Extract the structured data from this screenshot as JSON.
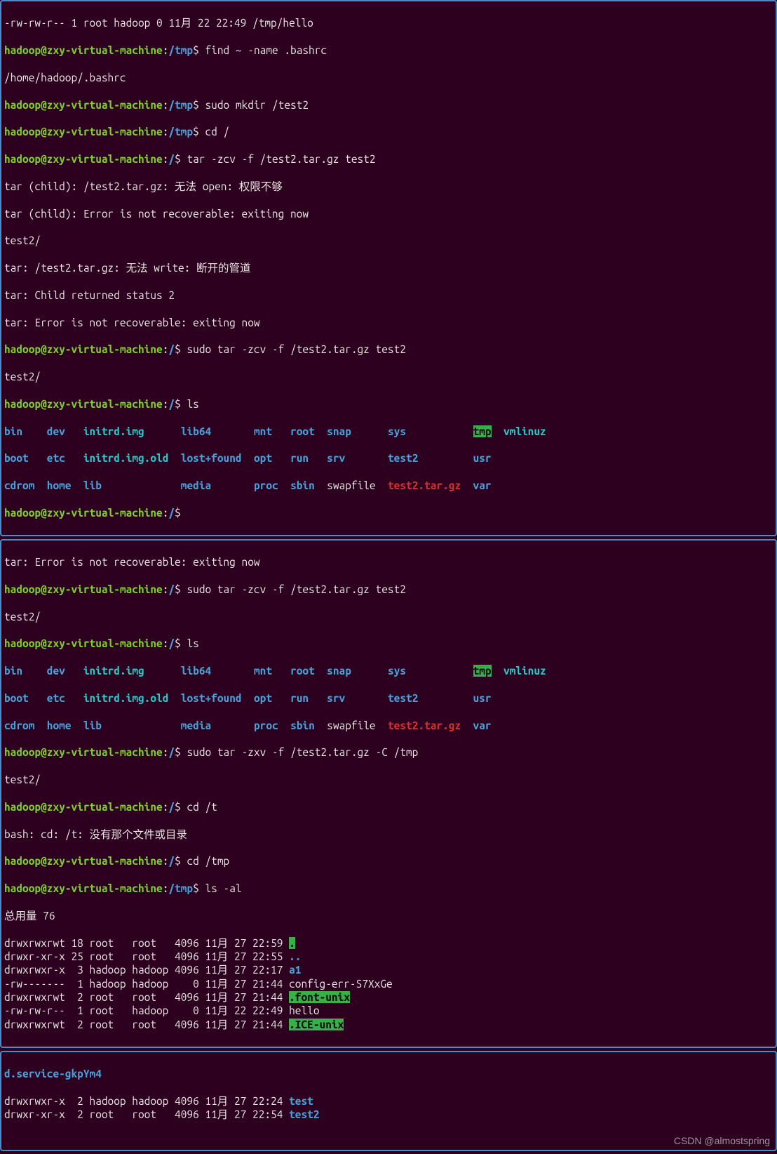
{
  "prompt": {
    "user": "hadoop",
    "host": "zxy-virtual-machine",
    "path_tmp": "/tmp",
    "path_root": "/",
    "sep": "@",
    "dollar": "$"
  },
  "p1": {
    "top_cut": "-rw-rw-r-- 1 root hadoop 0 11月 22 22:49 /tmp/hello",
    "cmd_find": "find ~ -name .bashrc",
    "find_out": "/home/hadoop/.bashrc",
    "cmd_mkdir": "sudo mkdir /test2",
    "cmd_cd_root": "cd /",
    "cmd_tar1": "tar -zcv -f /test2.tar.gz test2",
    "tar_err1": "tar (child): /test2.tar.gz: 无法 open: 权限不够",
    "tar_err2": "tar (child): Error is not recoverable: exiting now",
    "tar_out1": "test2/",
    "tar_err3": "tar: /test2.tar.gz: 无法 write: 断开的管道",
    "tar_err4": "tar: Child returned status 2",
    "tar_err5": "tar: Error is not recoverable: exiting now",
    "cmd_sudo_tar": "sudo tar -zcv -f /test2.tar.gz test2",
    "tar_out2": "test2/",
    "cmd_ls": "ls",
    "ls": {
      "r1": {
        "c1": "bin",
        "c2": "dev",
        "c3": "initrd.img",
        "c4": "lib64",
        "c5": "mnt",
        "c6": "root",
        "c7": "snap",
        "c8": "sys",
        "c9": "tmp",
        "c10": "vmlinuz"
      },
      "r2": {
        "c1": "boot",
        "c2": "etc",
        "c3": "initrd.img.old",
        "c4": "lost+found",
        "c5": "opt",
        "c6": "run",
        "c7": "srv",
        "c8": "test2",
        "c9": "usr"
      },
      "r3": {
        "c1": "cdrom",
        "c2": "home",
        "c3": "lib",
        "c4": "media",
        "c5": "proc",
        "c6": "sbin",
        "c7": "swapfile",
        "c8": "test2.tar.gz",
        "c9": "var"
      }
    }
  },
  "p2": {
    "top_cut": "tar: Error is not recoverable: exiting now",
    "cmd_sudo_tar": "sudo tar -zcv -f /test2.tar.gz test2",
    "tar_out": "test2/",
    "cmd_ls": "ls",
    "cmd_extract": "sudo tar -zxv -f /test2.tar.gz -C /tmp",
    "extract_out": "test2/",
    "cmd_cd_t": "cd /t",
    "cd_err": "bash: cd: /t: 没有那个文件或目录",
    "cmd_cd_tmp": "cd /tmp",
    "cmd_ls_al": "ls -al",
    "total": "总用量 76",
    "rows": [
      {
        "perm": "drwxrwxrwt",
        "n": "18",
        "u": "root",
        "g": "root",
        "s": "4096",
        "d": "11月 27 22:59",
        "name": ".",
        "cls": "hlgreen"
      },
      {
        "perm": "drwxr-xr-x",
        "n": "25",
        "u": "root",
        "g": "root",
        "s": "4096",
        "d": "11月 27 22:55",
        "name": "..",
        "cls": "dir"
      },
      {
        "perm": "drwxrwxr-x",
        "n": " 3",
        "u": "hadoop",
        "g": "hadoop",
        "s": "4096",
        "d": "11月 27 22:17",
        "name": "a1",
        "cls": "dir"
      },
      {
        "perm": "-rw-------",
        "n": " 1",
        "u": "hadoop",
        "g": "hadoop",
        "s": "   0",
        "d": "11月 27 21:44",
        "name": "config-err-S7XxGe",
        "cls": "white"
      },
      {
        "perm": "drwxrwxrwt",
        "n": " 2",
        "u": "root",
        "g": "root",
        "s": "4096",
        "d": "11月 27 21:44",
        "name": ".font-unix",
        "cls": "hlgreen"
      },
      {
        "perm": "-rw-rw-r--",
        "n": " 1",
        "u": "root",
        "g": "hadoop",
        "s": "   0",
        "d": "11月 22 22:49",
        "name": "hello",
        "cls": "white"
      },
      {
        "perm": "drwxrwxrwt",
        "n": " 2",
        "u": "root",
        "g": "root",
        "s": "4096",
        "d": "11月 27 21:44",
        "name": ".ICE-unix",
        "cls": "hlgreen"
      }
    ]
  },
  "p3": {
    "top_cut": "d.service-gkpYm4",
    "rows": [
      {
        "perm": "drwxrwxr-x",
        "n": " 2",
        "u": "hadoop",
        "g": "hadoop",
        "s": "4096",
        "d": "11月 27 22:24",
        "name": "test",
        "cls": "dir"
      },
      {
        "perm": "drwxr-xr-x",
        "n": " 2",
        "u": "root",
        "g": "root",
        "s": "4096",
        "d": "11月 27 22:54",
        "name": "test2",
        "cls": "dir"
      }
    ]
  },
  "watermark": "CSDN @almostspring"
}
